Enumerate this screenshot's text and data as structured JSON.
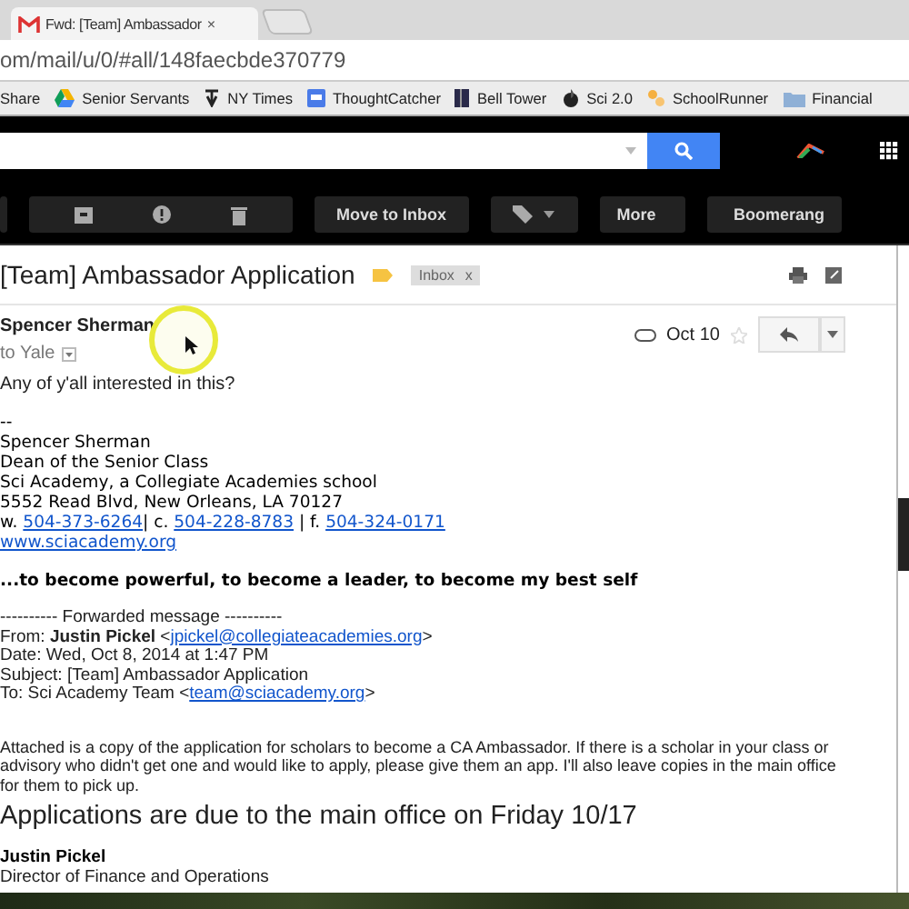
{
  "browser": {
    "tab": {
      "title": "Fwd: [Team] Ambassador",
      "close": "×"
    },
    "address": "om/mail/u/0/#all/148faecbde370779",
    "bookmarks": [
      {
        "label": "Share",
        "kind": "none"
      },
      {
        "label": "Senior Servants",
        "kind": "drive"
      },
      {
        "label": "NY Times",
        "kind": "nyt"
      },
      {
        "label": "ThoughtCatcher",
        "kind": "doc"
      },
      {
        "label": "Bell Tower",
        "kind": "book"
      },
      {
        "label": "Sci 2.0",
        "kind": "sci"
      },
      {
        "label": "SchoolRunner",
        "kind": "runner"
      },
      {
        "label": "Financial",
        "kind": "folder"
      }
    ]
  },
  "toolbar": {
    "buttons": [
      {
        "kind": "group"
      },
      {
        "kind": "text",
        "label": "Move to Inbox"
      },
      {
        "kind": "labels"
      },
      {
        "kind": "menu",
        "label": "More"
      },
      {
        "kind": "boomerang",
        "label": "Boomerang"
      }
    ]
  },
  "thread": {
    "subject": "[Team] Ambassador Application",
    "label": {
      "text": "Inbox",
      "close": "x"
    },
    "message": {
      "sender": "Spencer Sherman",
      "recipient": "to Yale",
      "date": "Oct 10",
      "starred": false,
      "body": [
        {
          "kind": "text",
          "segments": [
            {
              "kind": "text",
              "text": "Any of y'all interested in this?"
            }
          ]
        },
        {
          "kind": "sig_start",
          "segments": [
            {
              "kind": "text",
              "text": "--"
            }
          ]
        },
        {
          "kind": "sig",
          "segments": [
            {
              "kind": "text",
              "text": "Spencer Sherman"
            }
          ]
        },
        {
          "kind": "sig",
          "segments": [
            {
              "kind": "text",
              "text": "Dean of the Senior Class"
            }
          ]
        },
        {
          "kind": "sig",
          "segments": [
            {
              "kind": "text",
              "text": "Sci Academy, a Collegiate Academies school"
            }
          ]
        },
        {
          "kind": "sig",
          "segments": [
            {
              "kind": "text",
              "text": "5552 Read Blvd, New Orleans, LA 70127"
            }
          ]
        },
        {
          "kind": "sig",
          "segments": [
            {
              "kind": "text",
              "text": "w. "
            },
            {
              "kind": "link",
              "text": "504-373-6264"
            },
            {
              "kind": "text",
              "text": "| c. "
            },
            {
              "kind": "link",
              "text": "504-228-8783"
            },
            {
              "kind": "text",
              "text": " | f. "
            },
            {
              "kind": "link",
              "text": "504-324-0171"
            }
          ]
        },
        {
          "kind": "sig",
          "segments": [
            {
              "kind": "link",
              "text": "www.sciacademy.org"
            }
          ]
        },
        {
          "kind": "motto",
          "segments": [
            {
              "kind": "text",
              "text": "...to become powerful, to become a leader, to become my best self"
            }
          ]
        },
        {
          "kind": "fwd_start",
          "segments": [
            {
              "kind": "text",
              "text": "---------- Forwarded message ----------"
            }
          ]
        },
        {
          "kind": "fwd",
          "segments": [
            {
              "kind": "text",
              "text": "From: "
            },
            {
              "kind": "bold",
              "text": "Justin Pickel"
            },
            {
              "kind": "text",
              "text": " <"
            },
            {
              "kind": "link",
              "text": "jpickel@collegiateacademies.org"
            },
            {
              "kind": "text",
              "text": ">"
            }
          ]
        },
        {
          "kind": "fwd",
          "segments": [
            {
              "kind": "text",
              "text": "Date: Wed, Oct 8, 2014 at 1:47 PM"
            }
          ]
        },
        {
          "kind": "fwd",
          "segments": [
            {
              "kind": "text",
              "text": "Subject: [Team] Ambassador Application"
            }
          ]
        },
        {
          "kind": "fwd",
          "segments": [
            {
              "kind": "text",
              "text": "To: Sci Academy Team <"
            },
            {
              "kind": "link",
              "text": "team@sciacademy.org"
            },
            {
              "kind": "text",
              "text": ">"
            }
          ]
        },
        {
          "kind": "para",
          "segments": [
            {
              "kind": "text",
              "text": "Attached is a copy of the application for scholars to become a CA Ambassador.  If there is a scholar in your class or advisory who didn't get one and would like to apply, please give them an app.  I'll also leave copies in the main office for them to pick up."
            }
          ]
        },
        {
          "kind": "big",
          "segments": [
            {
              "kind": "text",
              "text": "Applications are due to the main office on Friday 10/17"
            }
          ]
        },
        {
          "kind": "name",
          "segments": [
            {
              "kind": "bold",
              "text": "Justin Pickel"
            }
          ]
        },
        {
          "kind": "fwd",
          "segments": [
            {
              "kind": "text",
              "text": "Director of Finance and Operations"
            }
          ]
        }
      ]
    }
  }
}
